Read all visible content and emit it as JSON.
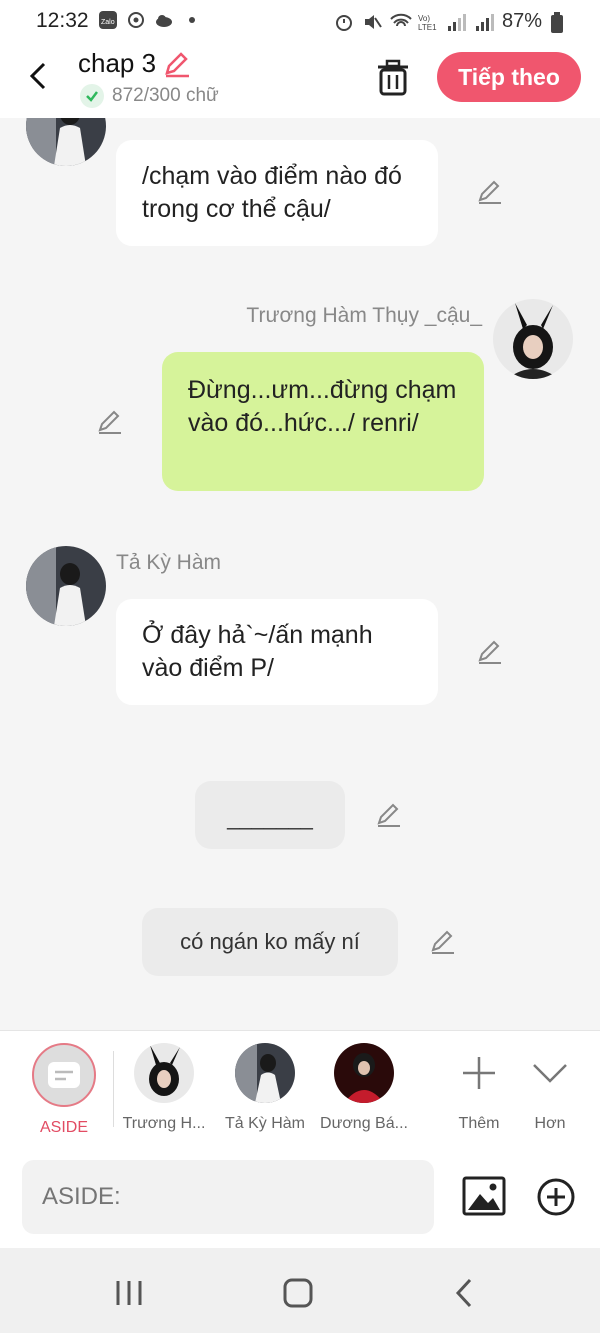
{
  "status_bar": {
    "time": "12:32",
    "battery": "87%"
  },
  "header": {
    "title": "chap 3",
    "word_count": "872/300 chữ",
    "next_label": "Tiếp theo",
    "accent": "#f0566e"
  },
  "messages": [
    {
      "type": "left",
      "text": "/chạm vào điểm nào đó trong cơ thể cậu/"
    },
    {
      "type": "right",
      "name": "Trương Hàm Thụy _cậu_",
      "text": "Đừng...ưm...đừng chạm vào đó...hức.../ renri/"
    },
    {
      "type": "left",
      "name": "Tả Kỳ Hàm",
      "text": "Ở đây hả`~/ấn mạnh vào điểm P/"
    },
    {
      "type": "aside",
      "text": "_______"
    },
    {
      "type": "aside",
      "text": "có ngán ko mấy ní"
    }
  ],
  "characters": [
    {
      "label": "ASIDE"
    },
    {
      "label": "Trương H..."
    },
    {
      "label": "Tả Kỳ Hàm"
    },
    {
      "label": "Dương Bá..."
    }
  ],
  "actions": {
    "add_label": "Thêm",
    "more_label": "Hơn"
  },
  "input": {
    "placeholder": "ASIDE:"
  }
}
